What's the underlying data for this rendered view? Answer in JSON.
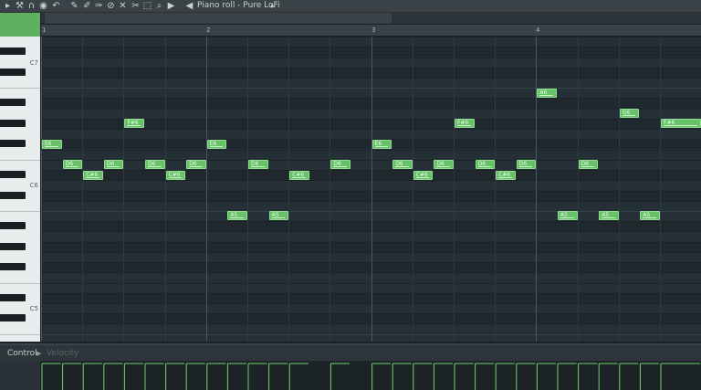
{
  "toolbar": {
    "title": "Piano roll - Pure LoFi",
    "icons": [
      "arrow-icon",
      "wrench-icon",
      "magnet-icon",
      "snap-icon",
      "undo-icon",
      "pencil-icon",
      "brush-icon",
      "eraser-icon",
      "mute-icon",
      "trim-icon",
      "select-icon",
      "zoom-icon",
      "play-icon",
      "speaker-icon"
    ]
  },
  "ruler": {
    "bars": [
      "1",
      "2",
      "3",
      "4"
    ]
  },
  "keyboard": {
    "octave_labels": [
      "C7",
      "C6",
      "C5"
    ]
  },
  "control": {
    "label": "Control",
    "param": "Velocity"
  },
  "colors": {
    "note": "#67c167",
    "grid_bg": "#253036",
    "accent": "#5fb05f"
  },
  "notes": [
    {
      "label": "E6",
      "pitch": "E6",
      "start": 0.0,
      "length": 0.5
    },
    {
      "label": "D6",
      "pitch": "D6",
      "start": 0.5,
      "length": 0.5
    },
    {
      "label": "C#6",
      "pitch": "C#6",
      "start": 1.0,
      "length": 0.5
    },
    {
      "label": "D6",
      "pitch": "D6",
      "start": 1.5,
      "length": 0.5
    },
    {
      "label": "F#6",
      "pitch": "F#6",
      "start": 2.0,
      "length": 0.5
    },
    {
      "label": "D6",
      "pitch": "D6",
      "start": 2.5,
      "length": 0.5
    },
    {
      "label": "C#6",
      "pitch": "C#6",
      "start": 3.0,
      "length": 0.5
    },
    {
      "label": "D6",
      "pitch": "D6",
      "start": 3.5,
      "length": 0.5
    },
    {
      "label": "E6",
      "pitch": "E6",
      "start": 4.0,
      "length": 0.5
    },
    {
      "label": "A5",
      "pitch": "A5",
      "start": 4.5,
      "length": 0.5
    },
    {
      "label": "D6",
      "pitch": "D6",
      "start": 5.0,
      "length": 0.5
    },
    {
      "label": "A5",
      "pitch": "A5",
      "start": 5.5,
      "length": 0.5
    },
    {
      "label": "C#6",
      "pitch": "C#6",
      "start": 6.0,
      "length": 0.5
    },
    {
      "label": "D6",
      "pitch": "D6",
      "start": 7.0,
      "length": 0.5
    },
    {
      "label": "E6",
      "pitch": "E6",
      "start": 8.0,
      "length": 0.5
    },
    {
      "label": "D6",
      "pitch": "D6",
      "start": 8.5,
      "length": 0.5
    },
    {
      "label": "C#6",
      "pitch": "C#6",
      "start": 9.0,
      "length": 0.5
    },
    {
      "label": "D6",
      "pitch": "D6",
      "start": 9.5,
      "length": 0.5
    },
    {
      "label": "F#6",
      "pitch": "F#6",
      "start": 10.0,
      "length": 0.5
    },
    {
      "label": "D6",
      "pitch": "D6",
      "start": 10.5,
      "length": 0.5
    },
    {
      "label": "C#6",
      "pitch": "C#6",
      "start": 11.0,
      "length": 0.5
    },
    {
      "label": "D6",
      "pitch": "D6",
      "start": 11.5,
      "length": 0.5
    },
    {
      "label": "A6",
      "pitch": "A6",
      "start": 12.0,
      "length": 0.5
    },
    {
      "label": "A5",
      "pitch": "A5",
      "start": 12.5,
      "length": 0.5
    },
    {
      "label": "D6",
      "pitch": "D6",
      "start": 13.0,
      "length": 0.5
    },
    {
      "label": "A5",
      "pitch": "A5",
      "start": 13.5,
      "length": 0.5
    },
    {
      "label": "G6",
      "pitch": "G6",
      "start": 14.0,
      "length": 0.5
    },
    {
      "label": "A5",
      "pitch": "A5",
      "start": 14.5,
      "length": 0.5
    },
    {
      "label": "F#6",
      "pitch": "F#6",
      "start": 15.0,
      "length": 1.0
    }
  ]
}
